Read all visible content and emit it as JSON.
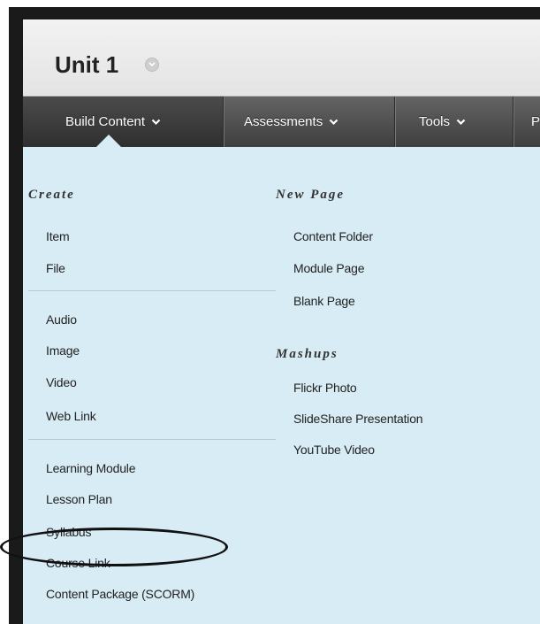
{
  "page": {
    "title": "Unit 1"
  },
  "nav": {
    "tabs": [
      {
        "label": "Build Content"
      },
      {
        "label": "Assessments"
      },
      {
        "label": "Tools"
      },
      {
        "label": "Pu"
      }
    ]
  },
  "menu": {
    "create": {
      "heading": "Create",
      "items": [
        "Item",
        "File",
        "Audio",
        "Image",
        "Video",
        "Web Link",
        "Learning Module",
        "Lesson Plan",
        "Syllabus",
        "Course Link",
        "Content Package (SCORM)"
      ]
    },
    "new_page": {
      "heading": "New Page",
      "items": [
        "Content Folder",
        "Module Page",
        "Blank Page"
      ]
    },
    "mashups": {
      "heading": "Mashups",
      "items": [
        "Flickr Photo",
        "SlideShare Presentation",
        "YouTube Video"
      ]
    }
  },
  "annotation": {
    "highlighted_item": "Course Link"
  }
}
